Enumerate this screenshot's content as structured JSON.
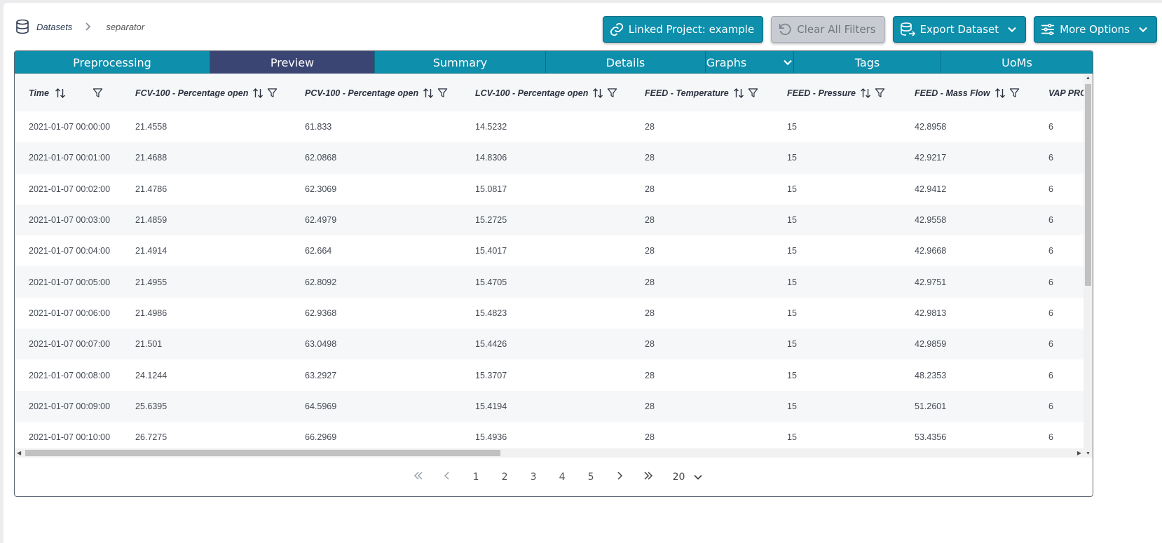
{
  "breadcrumb": {
    "root": "Datasets",
    "current": "separator"
  },
  "toolbar": {
    "linked_project": "Linked Project: example",
    "clear_filters": "Clear All Filters",
    "export": "Export Dataset",
    "more": "More Options"
  },
  "tabs": [
    {
      "label": "Preprocessing",
      "icon": ""
    },
    {
      "label": "Preview",
      "active": true
    },
    {
      "label": "Summary"
    },
    {
      "label": "Details"
    },
    {
      "label": "Graphs",
      "icon": "chevron-down-icon"
    },
    {
      "label": "Tags"
    },
    {
      "label": "UoMs"
    }
  ],
  "columns": [
    "Time",
    "FCV-100 - Percentage open",
    "PCV-100 - Percentage open",
    "LCV-100 - Percentage open",
    "FEED - Temperature",
    "FEED - Pressure",
    "FEED - Mass Flow",
    "VAP PRO"
  ],
  "rows": [
    [
      "2021-01-07 00:00:00",
      "21.4558",
      "61.833",
      "14.5232",
      "28",
      "15",
      "42.8958",
      "6"
    ],
    [
      "2021-01-07 00:01:00",
      "21.4688",
      "62.0868",
      "14.8306",
      "28",
      "15",
      "42.9217",
      "6"
    ],
    [
      "2021-01-07 00:02:00",
      "21.4786",
      "62.3069",
      "15.0817",
      "28",
      "15",
      "42.9412",
      "6"
    ],
    [
      "2021-01-07 00:03:00",
      "21.4859",
      "62.4979",
      "15.2725",
      "28",
      "15",
      "42.9558",
      "6"
    ],
    [
      "2021-01-07 00:04:00",
      "21.4914",
      "62.664",
      "15.4017",
      "28",
      "15",
      "42.9668",
      "6"
    ],
    [
      "2021-01-07 00:05:00",
      "21.4955",
      "62.8092",
      "15.4705",
      "28",
      "15",
      "42.9751",
      "6"
    ],
    [
      "2021-01-07 00:06:00",
      "21.4986",
      "62.9368",
      "15.4823",
      "28",
      "15",
      "42.9813",
      "6"
    ],
    [
      "2021-01-07 00:07:00",
      "21.501",
      "63.0498",
      "15.4426",
      "28",
      "15",
      "42.9859",
      "6"
    ],
    [
      "2021-01-07 00:08:00",
      "24.1244",
      "63.2927",
      "15.3707",
      "28",
      "15",
      "48.2353",
      "6"
    ],
    [
      "2021-01-07 00:09:00",
      "25.6395",
      "64.5969",
      "15.4194",
      "28",
      "15",
      "51.2601",
      "6"
    ],
    [
      "2021-01-07 00:10:00",
      "26.7275",
      "66.2969",
      "15.4936",
      "28",
      "15",
      "53.4356",
      "6"
    ]
  ],
  "pagination": {
    "first": "«",
    "prev": "‹",
    "pages": [
      "1",
      "2",
      "3",
      "4",
      "5"
    ],
    "next": "›",
    "last": "»",
    "page_size": "20"
  },
  "colors": {
    "accent": "#0e8fac",
    "active_tab": "#3a4574",
    "disabled": "#c8ccd2"
  }
}
